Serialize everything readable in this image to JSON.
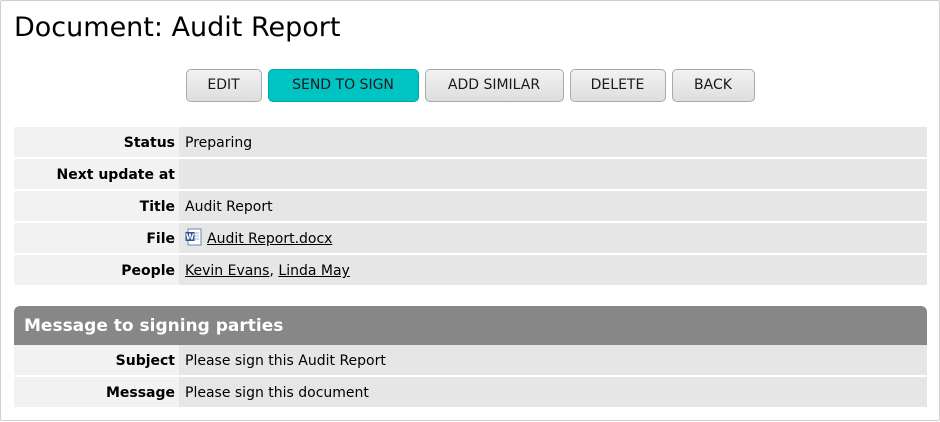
{
  "page": {
    "title": "Document: Audit Report"
  },
  "toolbar": {
    "edit_label": "EDIT",
    "send_label": "SEND TO SIGN",
    "add_similar_label": "ADD SIMILAR",
    "delete_label": "DELETE",
    "back_label": "BACK"
  },
  "details": {
    "rows": [
      {
        "label": "Status",
        "value": "Preparing"
      },
      {
        "label": "Next update at",
        "value": ""
      },
      {
        "label": "Title",
        "value": "Audit Report"
      },
      {
        "label": "File",
        "value": "Audit Report.docx",
        "icon": "word-document-icon"
      },
      {
        "label": "People",
        "people": [
          "Kevin Evans",
          "Linda May"
        ],
        "separator": ", "
      }
    ]
  },
  "message_section": {
    "title": "Message to signing parties",
    "rows": [
      {
        "label": "Subject",
        "value": "Please sign this Audit Report"
      },
      {
        "label": "Message",
        "value": "Please sign this document"
      }
    ]
  },
  "colors": {
    "primary_button": "#00c4c4",
    "section_header": "#878787",
    "label_bg": "#f2f2f2",
    "value_bg": "#e6e6e6"
  }
}
